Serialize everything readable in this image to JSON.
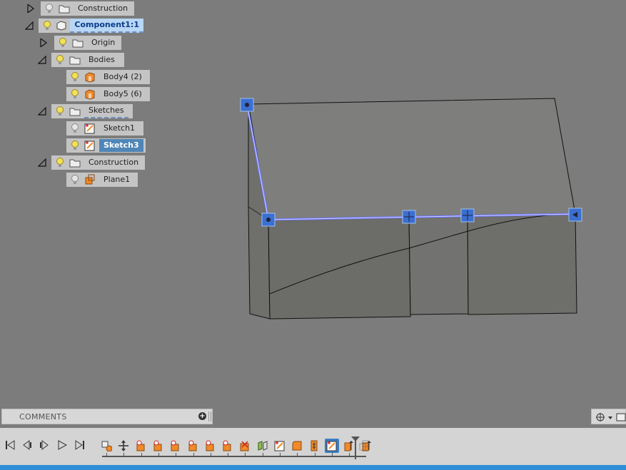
{
  "browser_tree": {
    "construction_top": {
      "label": "Construction"
    },
    "component": {
      "label": "Component1:1"
    },
    "origin": {
      "label": "Origin"
    },
    "bodies": {
      "label": "Bodies"
    },
    "body4": {
      "label": "Body4 (2)"
    },
    "body5": {
      "label": "Body5 (6)"
    },
    "sketches": {
      "label": "Sketches"
    },
    "sketch1": {
      "label": "Sketch1"
    },
    "sketch3": {
      "label": "Sketch3"
    },
    "construction": {
      "label": "Construction"
    },
    "plane1": {
      "label": "Plane1"
    }
  },
  "comments": {
    "title": "COMMENTS",
    "add_glyph": "+"
  },
  "timeline": {
    "playback": [
      "go-to-start-icon",
      "step-back-icon",
      "step-forward-icon",
      "play-icon",
      "go-to-end-icon"
    ],
    "features": [
      "new-component-icon",
      "move-icon",
      "extrude-icon",
      "extrude-icon",
      "extrude-icon",
      "extrude-icon",
      "extrude-icon",
      "extrude-icon",
      "delete-face-icon",
      "split-body-icon",
      "sketch-icon",
      "fillet-icon",
      "combine-icon",
      "sketch-icon",
      "offset-plane-icon",
      "offset-plane-icon"
    ],
    "active_feature": "sketch-icon"
  },
  "colors": {
    "viewport": "#7c7c7c",
    "selection": "#4f86b7",
    "sketch_line": "#6b72ff",
    "body_face": "#6f6f6a",
    "accent": "#2f8fd6"
  }
}
